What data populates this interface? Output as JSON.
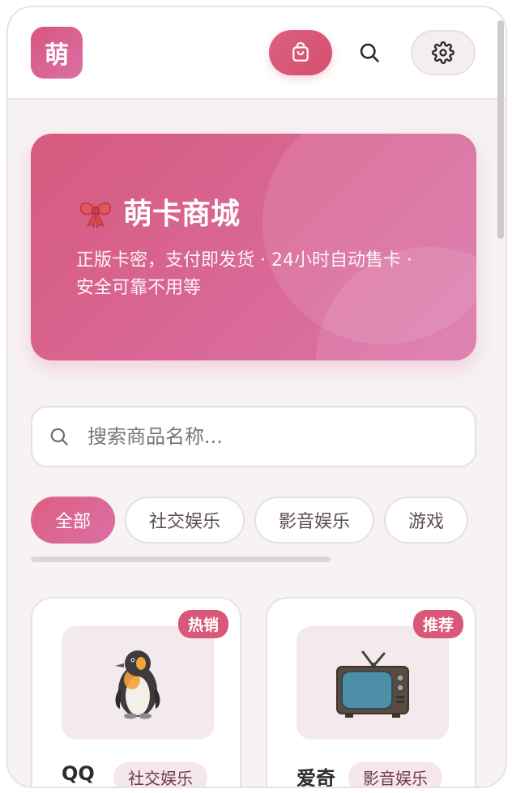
{
  "header": {
    "logo_text": "萌",
    "icons": [
      "shopping-bag-icon",
      "search-icon",
      "gear-icon"
    ]
  },
  "hero": {
    "title": "萌卡商城",
    "subtitle": "正版卡密，支付即发货 · 24小时自动售卡 · 安全可靠不用等",
    "emoji": "bow-icon"
  },
  "search": {
    "placeholder": "搜索商品名称..."
  },
  "categories": [
    {
      "label": "全部",
      "active": true
    },
    {
      "label": "社交娱乐",
      "active": false
    },
    {
      "label": "影音娱乐",
      "active": false
    },
    {
      "label": "游戏",
      "active": false
    }
  ],
  "products": [
    {
      "name": "QQ",
      "category": "社交娱乐",
      "badge": "热销",
      "icon": "penguin-icon"
    },
    {
      "name": "爱奇",
      "category": "影音娱乐",
      "badge": "推荐",
      "icon": "television-icon"
    }
  ],
  "colors": {
    "accent": "#d6577d",
    "accent_pink": "#dc6fa6",
    "background": "#f7f2f4"
  }
}
